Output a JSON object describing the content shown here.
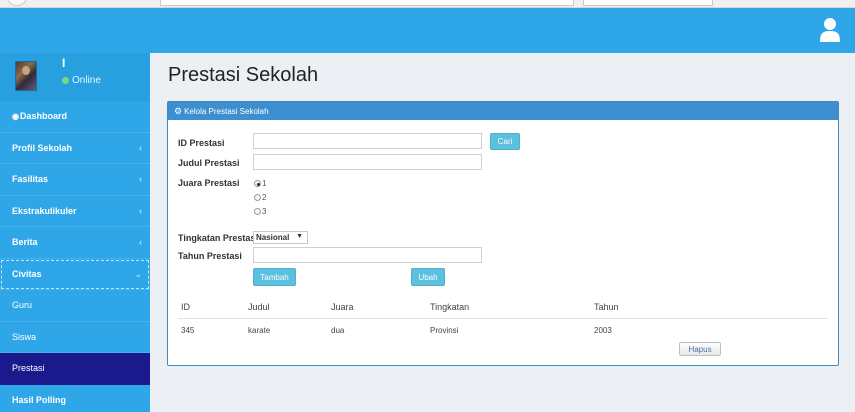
{
  "header": {
    "user_icon": "user-icon"
  },
  "sidebar": {
    "user": {
      "name": "I",
      "status": "Online"
    },
    "items": [
      {
        "label": "Dashboard",
        "icon": "dashboard-icon"
      },
      {
        "label": "Profil Sekolah",
        "caret": "‹"
      },
      {
        "label": "Fasilitas",
        "caret": "‹"
      },
      {
        "label": "Ekstrakulikuler",
        "caret": "‹"
      },
      {
        "label": "Berita",
        "caret": "‹"
      },
      {
        "label": "Civitas",
        "caret": "⌄"
      },
      {
        "label": "Guru"
      },
      {
        "label": "Siswa"
      },
      {
        "label": "Prestasi"
      },
      {
        "label": "Hasil Polling"
      }
    ]
  },
  "main": {
    "title": "Prestasi Sekolah",
    "box_title": "Kelola Prestasi Sekolah",
    "form": {
      "id_label": "ID Prestasi",
      "id_value": "",
      "search_button": "Cari",
      "judul_label": "Judul Prestasi",
      "judul_value": "",
      "juara_label": "Juara Prestasi",
      "juara_options": [
        "1",
        "2",
        "3"
      ],
      "juara_selected": "1",
      "tingkatan_label": "Tingkatan Prestasi",
      "tingkatan_value": "Nasional",
      "tahun_label": "Tahun Prestasi",
      "tahun_value": "",
      "add_button": "Tambah",
      "edit_button": "Ubah"
    },
    "table": {
      "headers": [
        "ID",
        "Judul",
        "Juara",
        "Tingkatan",
        "Tahun"
      ],
      "rows": [
        {
          "id": "345",
          "judul": "karate",
          "juara": "dua",
          "tingkatan": "Provinsi",
          "tahun": "2003",
          "delete_label": "Hapus"
        }
      ]
    }
  },
  "colors": {
    "header": "#2fa6e8",
    "sidebar": "#2fa6e8",
    "active_item": "#1a1a8c",
    "box_header": "#3d8fd0",
    "button": "#5bbfde"
  }
}
